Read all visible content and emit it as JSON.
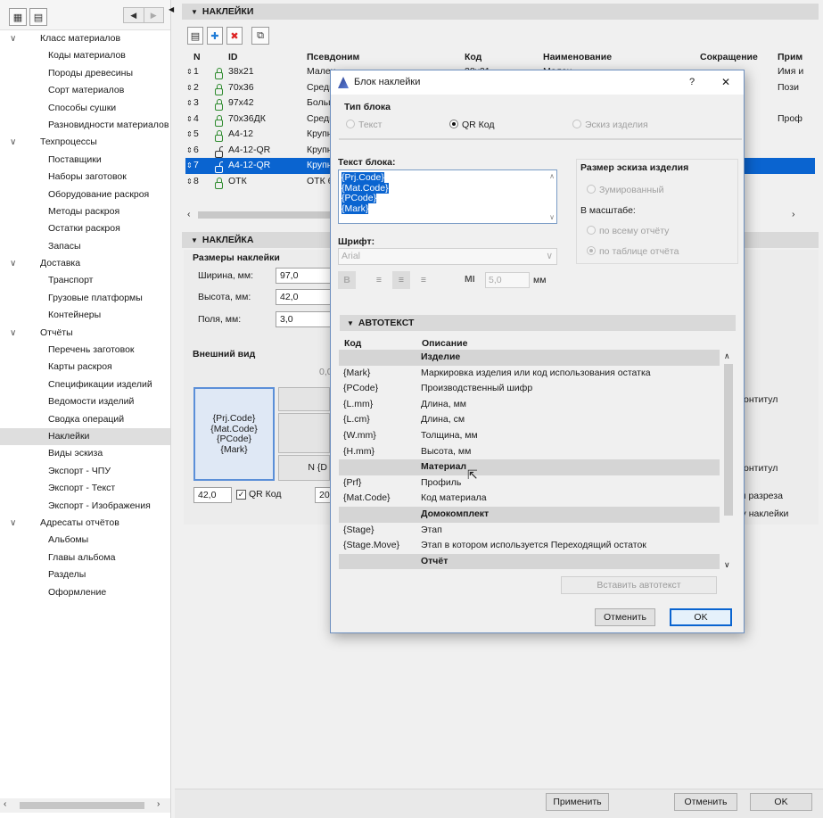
{
  "sidebar": {
    "items": [
      {
        "label": "Класс материалов",
        "level": 0,
        "expanded": true
      },
      {
        "label": "Коды материалов",
        "level": 1
      },
      {
        "label": "Породы древесины",
        "level": 1
      },
      {
        "label": "Сорт материалов",
        "level": 1
      },
      {
        "label": "Способы сушки",
        "level": 1
      },
      {
        "label": "Разновидности материалов",
        "level": 1
      },
      {
        "label": "Техпроцессы",
        "level": 0,
        "expanded": true
      },
      {
        "label": "Поставщики",
        "level": 1
      },
      {
        "label": "Наборы заготовок",
        "level": 1
      },
      {
        "label": "Оборудование раскроя",
        "level": 1
      },
      {
        "label": "Методы раскроя",
        "level": 1
      },
      {
        "label": "Остатки раскроя",
        "level": 1
      },
      {
        "label": "Запасы",
        "level": 1
      },
      {
        "label": "Доставка",
        "level": 0,
        "expanded": true
      },
      {
        "label": "Транспорт",
        "level": 1
      },
      {
        "label": "Грузовые платформы",
        "level": 1
      },
      {
        "label": "Контейнеры",
        "level": 1
      },
      {
        "label": "Отчёты",
        "level": 0,
        "expanded": true
      },
      {
        "label": "Перечень заготовок",
        "level": 1
      },
      {
        "label": "Карты раскроя",
        "level": 1
      },
      {
        "label": "Спецификации изделий",
        "level": 1
      },
      {
        "label": "Ведомости изделий",
        "level": 1
      },
      {
        "label": "Сводка операций",
        "level": 1
      },
      {
        "label": "Наклейки",
        "level": 1,
        "selected": true
      },
      {
        "label": "Виды эскиза",
        "level": 1
      },
      {
        "label": "Экспорт - ЧПУ",
        "level": 1
      },
      {
        "label": "Экспорт - Текст",
        "level": 1
      },
      {
        "label": "Экспорт - Изображения",
        "level": 1
      },
      {
        "label": "Адресаты отчётов",
        "level": 0,
        "expanded": true
      },
      {
        "label": "Альбомы",
        "level": 1
      },
      {
        "label": "Главы альбома",
        "level": 1
      },
      {
        "label": "Разделы",
        "level": 1
      },
      {
        "label": "Оформление",
        "level": 1
      }
    ]
  },
  "stickers": {
    "title": "НАКЛЕЙКИ",
    "columns": [
      "N",
      "ID",
      "Псевдоним",
      "Код",
      "Наименование",
      "Сокращение",
      "Прим"
    ],
    "rows": [
      {
        "n": "1",
        "id": "38x21",
        "alias": "Мален",
        "code": "38x21",
        "name": "Мален",
        "short": "",
        "note": "Имя и",
        "lock": "closed"
      },
      {
        "n": "2",
        "id": "70x36",
        "alias": "Средн",
        "code": "",
        "name": "",
        "short": "",
        "note": "Пози",
        "lock": "closed"
      },
      {
        "n": "3",
        "id": "97x42",
        "alias": "Больш",
        "code": "",
        "name": "",
        "short": "",
        "note": "",
        "lock": "closed"
      },
      {
        "n": "4",
        "id": "70x36ДК",
        "alias": "Средн",
        "code": "",
        "name": "",
        "short": "",
        "note": "Проф",
        "lock": "closed"
      },
      {
        "n": "5",
        "id": "A4-12",
        "alias": "Крупн",
        "code": "",
        "name": "",
        "short": "",
        "note": "",
        "lock": "closed"
      },
      {
        "n": "6",
        "id": "A4-12-QR",
        "alias": "Крупн",
        "code": "",
        "name": "",
        "short": "",
        "note": "",
        "lock": "open"
      },
      {
        "n": "7",
        "id": "A4-12-QR",
        "alias": "Крупн",
        "code": "",
        "name": "",
        "short": "",
        "note": "",
        "lock": "open",
        "selected": true
      },
      {
        "n": "8",
        "id": "ОТК",
        "alias": "ОТК 6",
        "code": "",
        "name": "",
        "short": "",
        "note": "",
        "lock": "closed"
      }
    ]
  },
  "sticker": {
    "title": "НАКЛЕЙКА",
    "sizes_title": "Размеры наклейки",
    "width_label": "Ширина, мм:",
    "width_value": "97,0",
    "height_label": "Высота, мм:",
    "height_value": "42,0",
    "margin_label": "Поля, мм:",
    "margin_value": "3,0",
    "appearance_title": "Внешний вид",
    "preview_lines": [
      "{Prj.Code}",
      "{Mat.Code}",
      "{PCode}",
      "{Mark}"
    ],
    "scale_tick": "0,0",
    "cell_label": "N {D",
    "size_value": "42,0",
    "qr_label": "QR Код",
    "small_value": "20",
    "right_texts": [
      "онтитул",
      "онтитул",
      "нии разреза",
      "гку наклейки"
    ]
  },
  "footer": {
    "apply": "Применить",
    "cancel": "Отменить",
    "ok": "OK"
  },
  "dialog": {
    "title": "Блок наклейки",
    "help": "?",
    "close": "✕",
    "block_type_label": "Тип блока",
    "type_text": "Текст",
    "type_qr": "QR Код",
    "type_sketch": "Эскиз изделия",
    "block_text_label": "Текст блока:",
    "block_text_lines": [
      "{Prj.Code}",
      "{Mat.Code}",
      "{PCode}",
      "{Mark}"
    ],
    "sketch_size_label": "Размер эскиза изделия",
    "zoomed": "Зумированный",
    "scale_label": "В масштабе:",
    "scale_whole": "по всему отчёту",
    "scale_table": "по таблице отчёта",
    "font_label": "Шрифт:",
    "font_value": "Arial",
    "font_size_value": "5,0",
    "font_size_unit": "мм",
    "autotext_title": "АВТОТЕКСТ",
    "autotext_col_code": "Код",
    "autotext_col_desc": "Описание",
    "autotext_rows": [
      {
        "code": "",
        "desc": "Изделие",
        "category": true
      },
      {
        "code": "{Mark}",
        "desc": "Маркировка изделия или код использования остатка"
      },
      {
        "code": "{PCode}",
        "desc": "Производственный шифр"
      },
      {
        "code": "{L.mm}",
        "desc": "Длина, мм"
      },
      {
        "code": "{L.cm}",
        "desc": "Длина, см"
      },
      {
        "code": "{W.mm}",
        "desc": "Толщина, мм"
      },
      {
        "code": "{H.mm}",
        "desc": "Высота, мм"
      },
      {
        "code": "",
        "desc": "Материал",
        "category": true
      },
      {
        "code": "{Prf}",
        "desc": "Профиль"
      },
      {
        "code": "{Mat.Code}",
        "desc": "Код материала"
      },
      {
        "code": "",
        "desc": "Домокомплект",
        "category": true
      },
      {
        "code": "{Stage}",
        "desc": "Этап"
      },
      {
        "code": "{Stage.Move}",
        "desc": "Этап в котором используется Переходящий остаток"
      },
      {
        "code": "",
        "desc": "Отчёт",
        "category": true
      }
    ],
    "insert_autotext": "Вставить автотекст",
    "cancel": "Отменить",
    "ok": "OK"
  }
}
